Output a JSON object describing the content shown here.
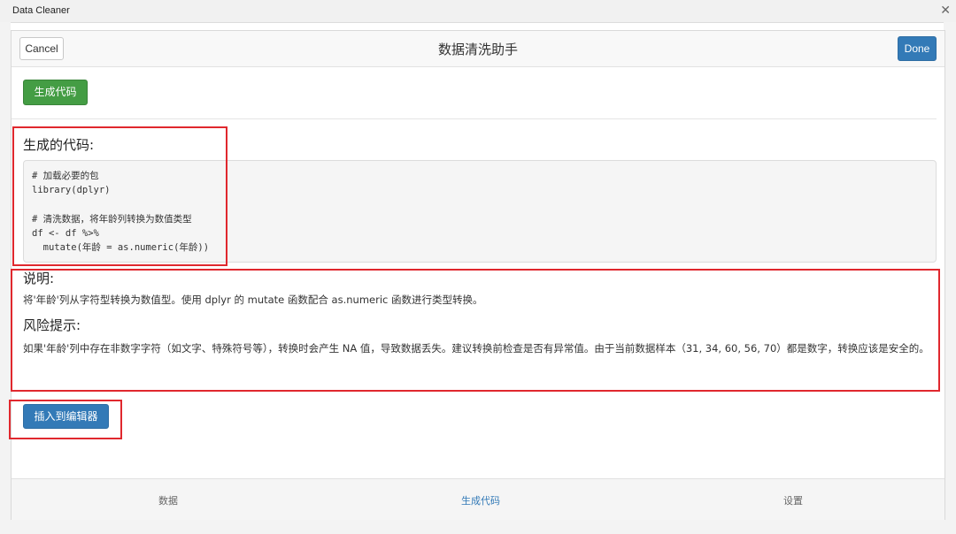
{
  "window": {
    "title": "Data Cleaner",
    "close_glyph": "✕"
  },
  "dialog": {
    "title": "数据清洗助手",
    "cancel_label": "Cancel",
    "done_label": "Done",
    "generate_label": "生成代码",
    "code_heading": "生成的代码:",
    "code": "# 加载必要的包\nlibrary(dplyr)\n\n# 清洗数据，将年龄列转换为数值类型\ndf <- df %>%\n  mutate(年龄 = as.numeric(年龄))",
    "explain_heading": "说明:",
    "explain_text": "将'年龄'列从字符型转换为数值型。使用 dplyr 的 mutate 函数配合 as.numeric 函数进行类型转换。",
    "risk_heading": "风险提示:",
    "risk_text": "如果'年龄'列中存在非数字字符（如文字、特殊符号等），转换时会产生 NA 值，导致数据丢失。建议转换前检查是否有异常值。由于当前数据样本（31, 34, 60, 56, 70）都是数字，转换应该是安全的。",
    "insert_label": "插入到编辑器"
  },
  "tabs": [
    {
      "label": "数据",
      "active": false
    },
    {
      "label": "生成代码",
      "active": true
    },
    {
      "label": "设置",
      "active": false
    }
  ],
  "colors": {
    "primary": "#337ab7",
    "success": "#449d44",
    "highlight": "#e0282e"
  }
}
